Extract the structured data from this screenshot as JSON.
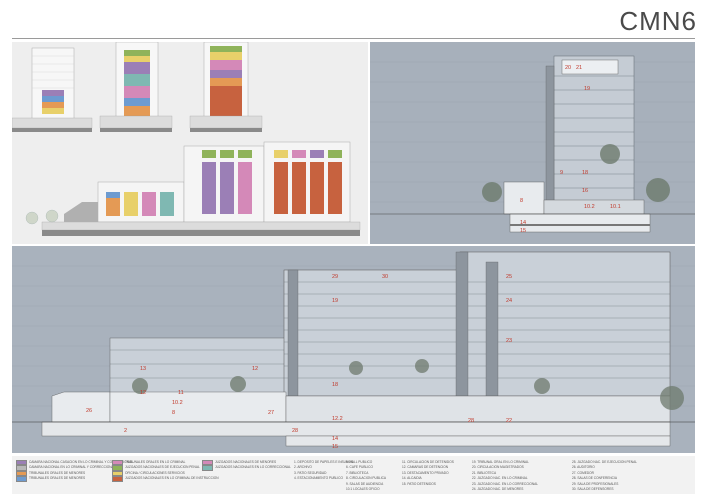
{
  "header": {
    "title": "CMN6"
  },
  "section_top_right": {
    "labels": [
      "20",
      "21",
      "19",
      "9",
      "18",
      "16",
      "8",
      "10.2",
      "10.1",
      "14",
      "15"
    ]
  },
  "section_bottom": {
    "labels": [
      "29",
      "30",
      "25",
      "19",
      "24",
      "23",
      "13",
      "12",
      "18",
      "12",
      "11",
      "26",
      "10.2",
      "8",
      "27",
      "12.2",
      "28",
      "22",
      "2",
      "28",
      "14",
      "15"
    ]
  },
  "legend": {
    "colors": {
      "purple": "#9b7fb6",
      "green": "#8fb35a",
      "orange": "#e49a55",
      "blue": "#6d9bd0",
      "red": "#c7623f",
      "yellow": "#e8d06a",
      "pink": "#d489b8",
      "teal": "#7fb8b2",
      "grey": "#b8b8b8"
    },
    "col1": [
      {
        "color": "purple",
        "text": "CAMARA NACIONAL CASACION EN LO CRIMINAL Y CORRECCIONAL"
      },
      {
        "color": "grey",
        "text": "CAMARA NACIONAL EN LO CRIMINAL Y CORRECCIONAL"
      },
      {
        "color": "orange",
        "text": "TRIBUNALES ORALES DE MENORES"
      },
      {
        "color": "blue",
        "text": "TRIBUNALES ORALES DE MENORES"
      }
    ],
    "col2": [
      {
        "color": "pink",
        "text": "TRIBUNALES ORALES EN LO CRIMINAL"
      },
      {
        "color": "green",
        "text": "JUZGADOS NACIONALES DE EJECUCION PENAL"
      },
      {
        "color": "yellow",
        "text": "OFICINA / CIRCULACIONES SERVICIOS"
      },
      {
        "color": "red",
        "text": "JUZGADOS NACIONALES EN LO CRIMINAL DE INSTRUCCION"
      }
    ],
    "col3": [
      {
        "color": "pink",
        "text": "JUZGADOS NACIONALES DE MENORES"
      },
      {
        "color": "teal",
        "text": "JUZGADOS NACIONALES EN LO CORRECCIONAL"
      }
    ],
    "col4": [
      "1. DEPOSITO DE PAPELES E INSUMOS",
      "2. ARCHIVO",
      "3. PATIO SEGURIDAD",
      "4. ESTACIONAMIENTO PUBLICO"
    ],
    "col5": [
      "5. HALL PUBLICO",
      "6. CAFE PUBLICO",
      "7. BIBLIOTECA",
      "8. CIRCULACION PUBLICA",
      "9. SALAS DE AUDIENCIA",
      "10.1 LOCALES OFICIO"
    ],
    "col6": [
      "11. CIRCULACION DE DETENIDOS",
      "12. CAMARAS DE DETENCION",
      "13. DESTACAMENTO PRIVADO",
      "14. ALCAIDIA",
      "15. PATIO DETENIDOS"
    ],
    "col7": [
      "19. TRIBUNAL ORAL EN LO CRIMINAL",
      "20. CIRCULACION MAGISTRADOS",
      "21. BIBLIOTECA",
      "22. JUZGADO NAC. EN LO CRIMINAL",
      "23. JUZGADO NAC. EN LO CORRECCIONAL",
      "24. JUZGADO NAC. DE MENORES"
    ],
    "col8": [
      "25. JUZGADO NAC. DE EJECUCION PENAL",
      "26. AUDITORIO",
      "27. COMEDOR",
      "28. SALAS DE CONFERENCIA",
      "29. SALA DE PROFESIONALES",
      "30. SALA DE DEFENSORES"
    ]
  }
}
